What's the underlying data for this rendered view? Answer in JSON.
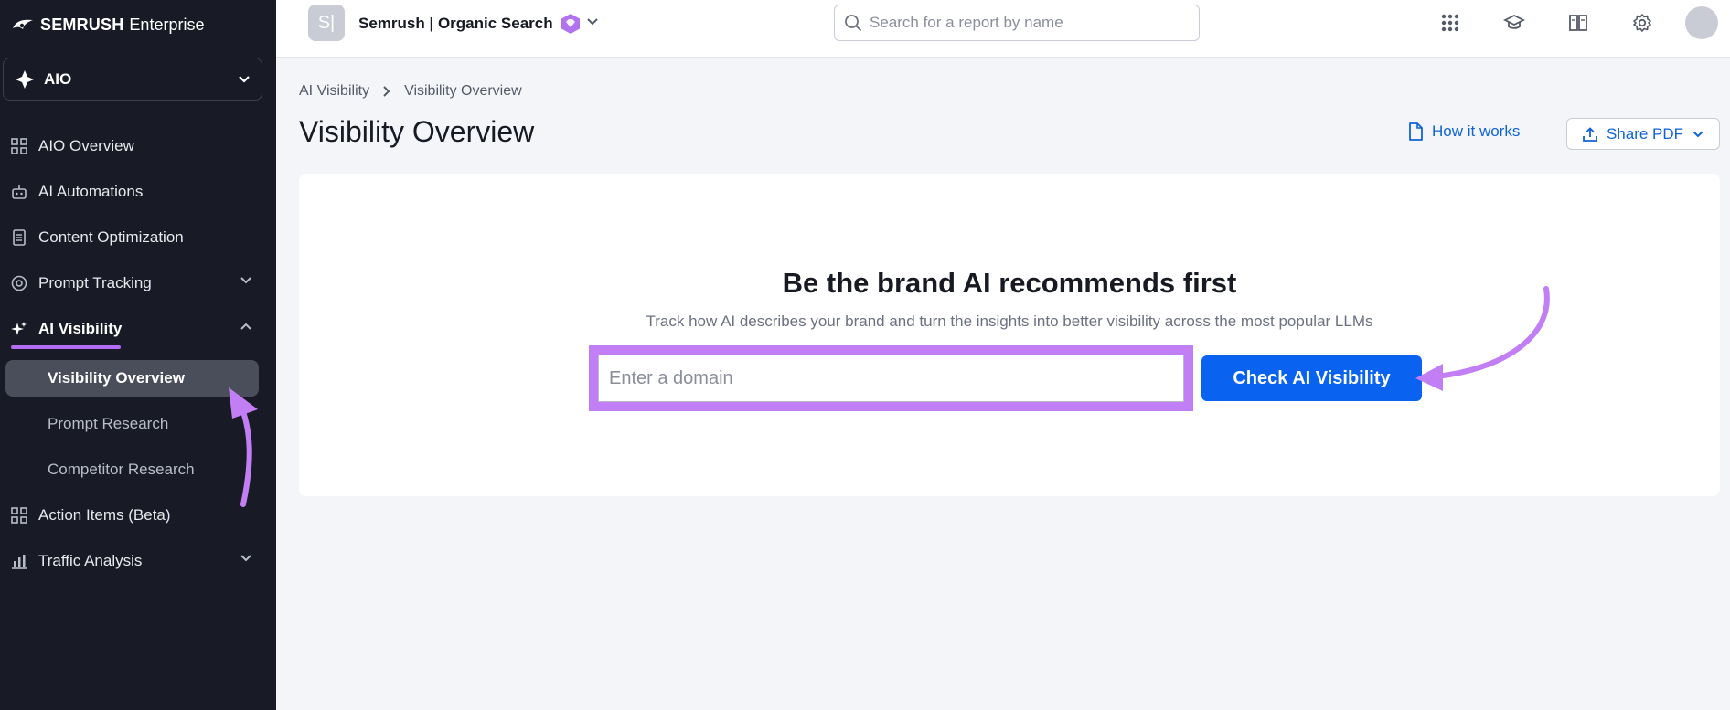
{
  "app": {
    "logo_brand": "SEMRUSH",
    "logo_product": "Enterprise",
    "workspace": "AIO"
  },
  "sidebar": {
    "items": [
      {
        "label": "AIO Overview",
        "icon": "grid-icon"
      },
      {
        "label": "AI Automations",
        "icon": "robot-icon"
      },
      {
        "label": "Content Optimization",
        "icon": "document-icon"
      },
      {
        "label": "Prompt Tracking",
        "icon": "target-icon"
      },
      {
        "label": "AI Visibility",
        "icon": "sparkle-icon"
      },
      {
        "label": "Action Items (Beta)",
        "icon": "grid-icon"
      },
      {
        "label": "Traffic Analysis",
        "icon": "bar-chart-icon"
      }
    ],
    "subitems": [
      {
        "label": "Visibility Overview"
      },
      {
        "label": "Prompt Research"
      },
      {
        "label": "Competitor Research"
      }
    ]
  },
  "topbar": {
    "project_initial": "S|",
    "project_name": "Semrush | Organic Search",
    "search_placeholder": "Search for a report by name"
  },
  "breadcrumb": {
    "parent": "AI Visibility",
    "current": "Visibility Overview"
  },
  "page": {
    "title": "Visibility Overview",
    "how_it_works": "How it works",
    "share_pdf": "Share PDF"
  },
  "hero": {
    "headline": "Be the brand AI recommends first",
    "subline": "Track how AI describes your brand and turn the insights into better visibility across the most popular LLMs",
    "domain_placeholder": "Enter a domain",
    "domain_value": "",
    "check_button": "Check AI Visibility"
  },
  "colors": {
    "sidebar_bg": "#181b25",
    "accent_purple": "#c27ff5",
    "primary_blue": "#0a63f0",
    "link_blue": "#0f63d6"
  }
}
